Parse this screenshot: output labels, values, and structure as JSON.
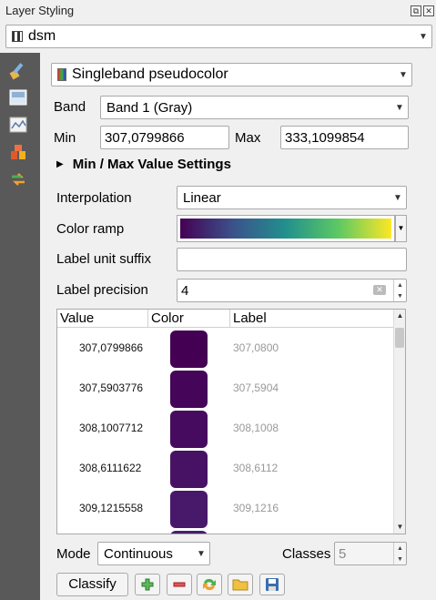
{
  "panel": {
    "title": "Layer Styling",
    "float_icon": "float-icon",
    "close_icon": "close-icon"
  },
  "layer": {
    "name": "dsm",
    "icon": "raster-layer-icon"
  },
  "sidebar": {
    "icons": [
      "paintbrush-icon",
      "transparency-icon",
      "histogram-icon",
      "rendering-icon",
      "history-icon"
    ]
  },
  "renderer": {
    "type": "Singleband pseudocolor",
    "icon": "pseudocolor-icon"
  },
  "band": {
    "label": "Band",
    "value": "Band 1 (Gray)"
  },
  "minmax": {
    "min_label": "Min",
    "min_value": "307,0799866",
    "max_label": "Max",
    "max_value": "333,1099854"
  },
  "minmax_settings": {
    "label": "Min / Max Value Settings"
  },
  "interpolation": {
    "label": "Interpolation",
    "value": "Linear"
  },
  "color_ramp": {
    "label": "Color ramp",
    "colors": [
      "#440154",
      "#3b528b",
      "#21908d",
      "#5dc963",
      "#fde725"
    ]
  },
  "unit_suffix": {
    "label": "Label unit suffix",
    "value": ""
  },
  "precision": {
    "label": "Label precision",
    "value": "4"
  },
  "table": {
    "headers": [
      "Value",
      "Color",
      "Label"
    ],
    "rows": [
      {
        "value": "307,0799866",
        "color": "#440154",
        "label": "307,0800"
      },
      {
        "value": "307,5903776",
        "color": "#45065a",
        "label": "307,5904"
      },
      {
        "value": "308,1007712",
        "color": "#460b5e",
        "label": "308,1008"
      },
      {
        "value": "308,6111622",
        "color": "#471264",
        "label": "308,6112"
      },
      {
        "value": "309,1215558",
        "color": "#48186a",
        "label": "309,1216"
      },
      {
        "value": "",
        "color": "#481e6f",
        "label": ""
      }
    ]
  },
  "mode": {
    "label": "Mode",
    "value": "Continuous"
  },
  "classes": {
    "label": "Classes",
    "value": "5"
  },
  "buttons": {
    "classify": "Classify",
    "add_icon": "add-icon",
    "remove_icon": "remove-icon",
    "reverse_icon": "reverse-icon",
    "load_icon": "folder-icon",
    "save_icon": "save-icon"
  }
}
